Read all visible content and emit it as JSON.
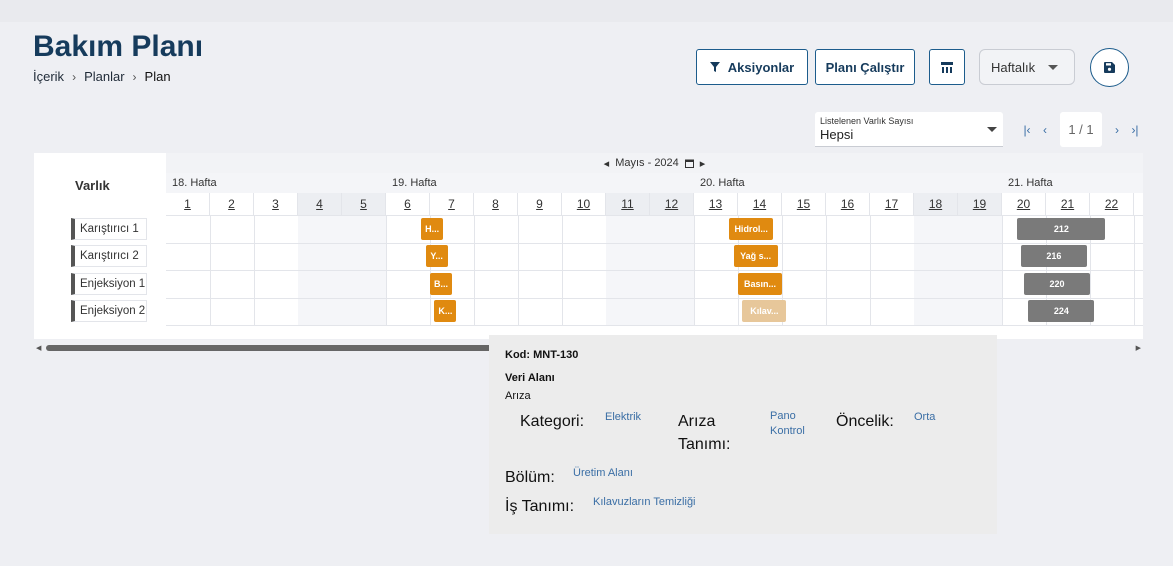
{
  "header": {
    "title": "Bakım Planı",
    "breadcrumb": [
      "İçerik",
      "Planlar",
      "Plan"
    ]
  },
  "toolbar": {
    "actions_label": "Aksiyonlar",
    "run_plan_label": "Planı Çalıştır",
    "view_select": "Haftalık",
    "save_icon": "save-icon",
    "calendar_icon": "calendar-view-icon",
    "filter_icon": "filter-icon"
  },
  "asset_count": {
    "label": "Listelenen Varlık Sayısı",
    "value": "Hepsi"
  },
  "pagination": {
    "page": "1 / 1"
  },
  "gantt": {
    "asset_header": "Varlık",
    "month": "Mayıs - 2024",
    "weeks": [
      {
        "label": "18. Hafta",
        "start_index": 0
      },
      {
        "label": "19. Hafta",
        "start_index": 5
      },
      {
        "label": "20. Hafta",
        "start_index": 12
      },
      {
        "label": "21. Hafta",
        "start_index": 19
      }
    ],
    "days": [
      "1",
      "2",
      "3",
      "4",
      "5",
      "6",
      "7",
      "8",
      "9",
      "10",
      "11",
      "12",
      "13",
      "14",
      "15",
      "16",
      "17",
      "18",
      "19",
      "20",
      "21",
      "22"
    ],
    "weekend_day_indices": [
      3,
      4,
      10,
      11,
      17,
      18
    ],
    "assets": [
      "Karıştırıcı 1",
      "Karıştırıcı 2",
      "Enjeksiyon 1",
      "Enjeksiyon 2"
    ],
    "tasks": [
      {
        "row": 0,
        "day_start": 5.8,
        "duration_days": 0.5,
        "label": "H...",
        "style": "orange"
      },
      {
        "row": 1,
        "day_start": 5.9,
        "duration_days": 0.5,
        "label": "Y...",
        "style": "orange"
      },
      {
        "row": 2,
        "day_start": 6.0,
        "duration_days": 0.5,
        "label": "B...",
        "style": "orange"
      },
      {
        "row": 3,
        "day_start": 6.1,
        "duration_days": 0.5,
        "label": "K...",
        "style": "orange"
      },
      {
        "row": 0,
        "day_start": 12.8,
        "duration_days": 1.0,
        "label": "Hidrol...",
        "style": "orange"
      },
      {
        "row": 1,
        "day_start": 12.9,
        "duration_days": 1.0,
        "label": "Yağ s...",
        "style": "orange"
      },
      {
        "row": 2,
        "day_start": 13.0,
        "duration_days": 1.0,
        "label": "Basın...",
        "style": "orange"
      },
      {
        "row": 3,
        "day_start": 13.1,
        "duration_days": 1.0,
        "label": "Kılav...",
        "style": "light"
      },
      {
        "row": 0,
        "day_start": 19.35,
        "duration_days": 2.0,
        "label": "212",
        "style": "gray"
      },
      {
        "row": 1,
        "day_start": 19.43,
        "duration_days": 1.5,
        "label": "216",
        "style": "gray"
      },
      {
        "row": 2,
        "day_start": 19.5,
        "duration_days": 1.5,
        "label": "220",
        "style": "gray"
      },
      {
        "row": 3,
        "day_start": 19.6,
        "duration_days": 1.5,
        "label": "224",
        "style": "gray"
      }
    ]
  },
  "tooltip": {
    "code": "Kod: MNT-130",
    "data_area_label": "Veri Alanı",
    "data_area_value": "Arıza",
    "category_key": "Kategori:",
    "category_value": "Elektrik",
    "fault_key": "Arıza Tanımı:",
    "fault_value": "Pano Kontrol",
    "priority_key": "Öncelik:",
    "priority_value": "Orta",
    "department_key": "Bölüm:",
    "department_value": "Üretim Alanı",
    "job_key": "İş Tanımı:",
    "job_value": "Kılavuzların Temizliği"
  },
  "colors": {
    "primary": "#163b5c",
    "task_orange": "#e08a10",
    "task_light": "#e7c79a",
    "task_gray": "#7a7a7a"
  }
}
